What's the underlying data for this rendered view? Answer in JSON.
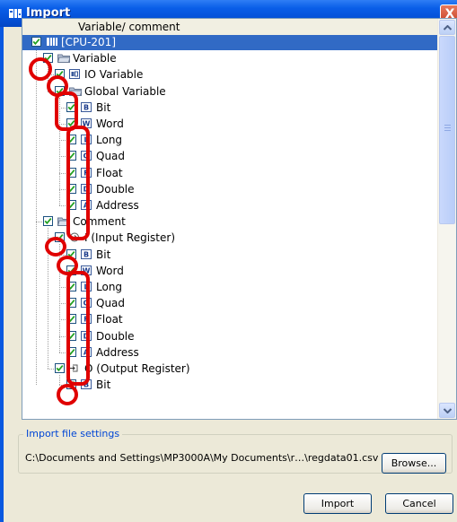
{
  "window": {
    "title": "Import",
    "close_glyph": "X"
  },
  "tree": {
    "column_header": "Variable/ comment",
    "selected_color": "#316ac5",
    "nodes": [
      {
        "label": "[CPU-201]",
        "icon": "cpu-icon",
        "selected": true
      },
      {
        "label": "Variable",
        "icon": "folder-icon"
      },
      {
        "label": "IO Variable",
        "icon": "io-variable-icon"
      },
      {
        "label": "Global Variable",
        "icon": "folder-icon"
      },
      {
        "label": "Bit",
        "icon": "type-b-icon"
      },
      {
        "label": "Word",
        "icon": "type-w-icon"
      },
      {
        "label": "Long",
        "icon": "type-l-icon"
      },
      {
        "label": "Quad",
        "icon": "type-q-icon"
      },
      {
        "label": "Float",
        "icon": "type-f-icon"
      },
      {
        "label": "Double",
        "icon": "type-d-icon"
      },
      {
        "label": "Address",
        "icon": "type-a-icon"
      },
      {
        "label": "Comment",
        "icon": "folder-icon"
      },
      {
        "label": "I (Input Register)",
        "icon": "input-register-icon"
      },
      {
        "label": "Bit",
        "icon": "type-b-icon"
      },
      {
        "label": "Word",
        "icon": "type-w-icon"
      },
      {
        "label": "Long",
        "icon": "type-l-icon"
      },
      {
        "label": "Quad",
        "icon": "type-q-icon"
      },
      {
        "label": "Float",
        "icon": "type-f-icon"
      },
      {
        "label": "Double",
        "icon": "type-d-icon"
      },
      {
        "label": "Address",
        "icon": "type-a-icon"
      },
      {
        "label": "O (Output Register)",
        "icon": "output-register-icon"
      },
      {
        "label": "Bit",
        "icon": "type-b-icon"
      }
    ]
  },
  "settings": {
    "legend": "Import file settings",
    "file_path": "C:\\Documents and Settings\\MP3000A\\My Documents\\r…\\regdata01.csv",
    "browse_label": "Browse..."
  },
  "buttons": {
    "import_label": "Import",
    "cancel_label": "Cancel"
  },
  "colors": {
    "title_bar": "#0a58e0",
    "annotation_red": "#e00000",
    "legend_blue": "#0046d5"
  }
}
